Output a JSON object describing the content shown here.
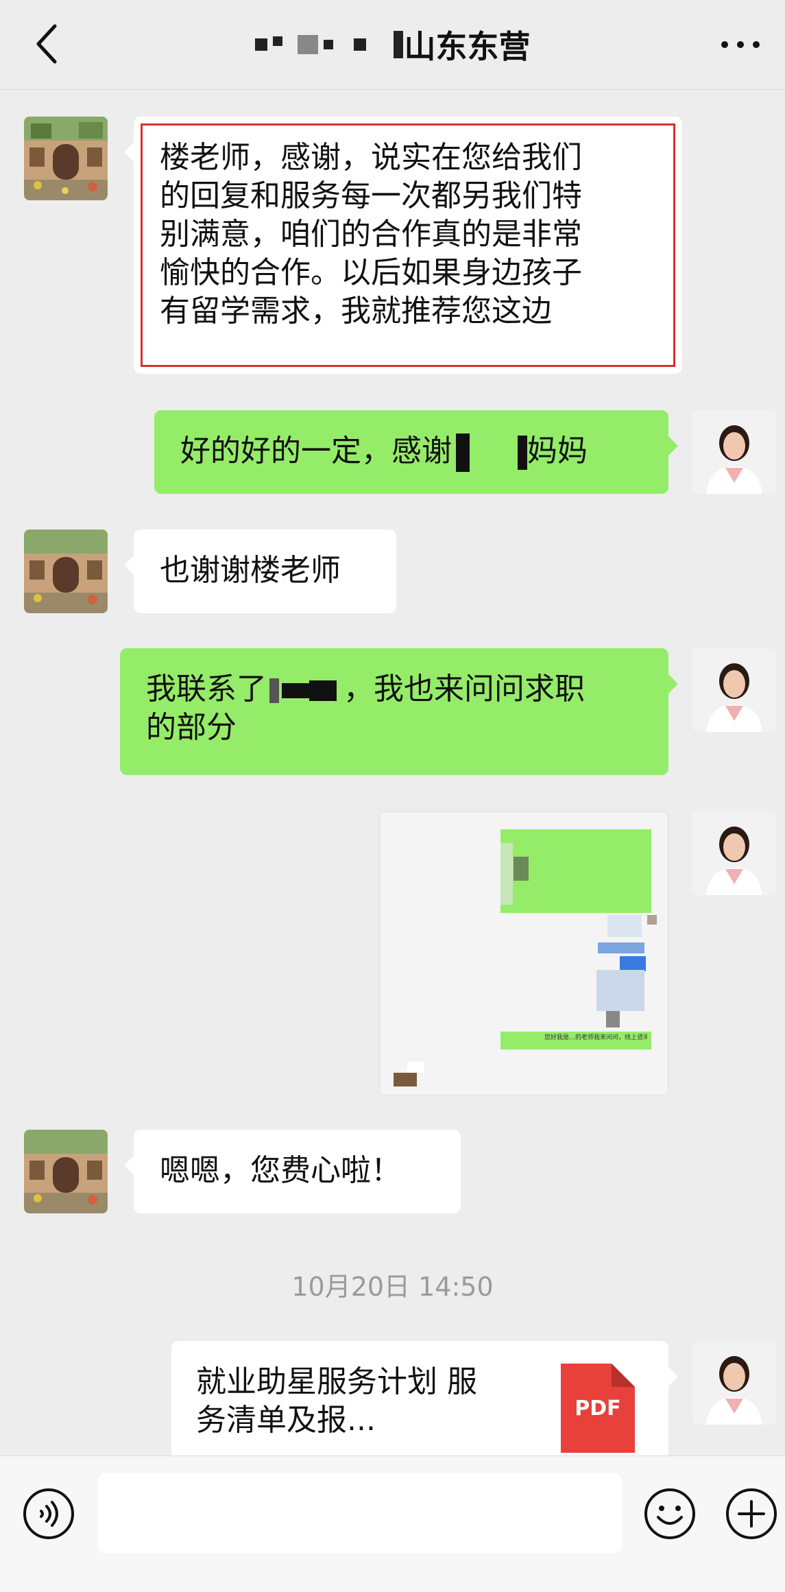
{
  "header": {
    "title_suffix": "山东东营",
    "back_icon": "chevron-left-icon",
    "more_icon": "ellipsis-icon"
  },
  "messages": [
    {
      "side": "left",
      "text": "楼老师，感谢，说实在您给我们的回复和服务每一次都另我们特别满意，咱们的合作真的是非常愉快的合作。以后如果身边孩子有留学需求，我就推荐您这边",
      "lines": [
        "楼老师，感谢，说实在您给我们",
        "的回复和服务每一次都另我们特",
        "别满意，咱们的合作真的是非常",
        "愉快的合作。以后如果身边孩子",
        "有留学需求，我就推荐您这边"
      ]
    },
    {
      "side": "right",
      "text_before": "好的好的一定，感谢",
      "text_after": "妈妈"
    },
    {
      "side": "left",
      "text": "也谢谢楼老师"
    },
    {
      "side": "right",
      "line1_before": "我联系了",
      "line1_after": "，我也来问问求职",
      "line2": "的部分"
    },
    {
      "side": "right",
      "type": "image",
      "caption": "您好我是…的老师我来问问，线上咨询可以"
    },
    {
      "side": "left",
      "text": "嗯嗯，您费心啦！"
    }
  ],
  "timestamp": "10月20日 14:50",
  "file": {
    "title_line1": "就业助星服务计划 服",
    "title_line2": "务清单及报...",
    "badge": "PDF",
    "badge_color": "#e8403a"
  },
  "colors": {
    "bg": "#ededed",
    "green": "#95ec69",
    "white": "#ffffff",
    "red_border": "#d9302b"
  },
  "bottom": {
    "voice_icon": "voice-icon",
    "emoji_icon": "smile-icon",
    "plus_icon": "plus-icon"
  }
}
